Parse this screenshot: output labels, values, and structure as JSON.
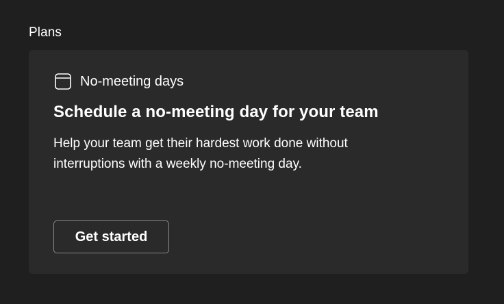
{
  "section": {
    "heading": "Plans"
  },
  "card": {
    "category_icon": "calendar-icon",
    "category_label": "No-meeting days",
    "title": "Schedule a no-meeting day for your team",
    "description": "Help your team get their hardest work done without interruptions with a weekly no-meeting day.",
    "button_label": "Get started"
  },
  "colors": {
    "background": "#1f1f1f",
    "card_background": "#2a2a2a",
    "text": "#ffffff",
    "button_border": "#8a8a8a"
  }
}
